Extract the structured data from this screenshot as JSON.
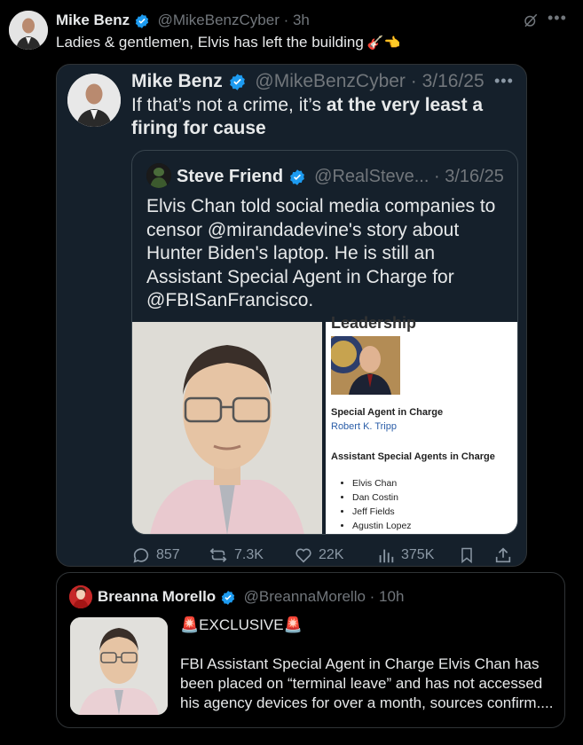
{
  "main_tweet": {
    "author_name": "Mike Benz",
    "handle_time": "@MikeBenzCyber · 3h",
    "text": "Ladies & gentlemen, Elvis has left the building",
    "emoji": "🎸👈"
  },
  "quote_tweet": {
    "author_name": "Mike Benz",
    "handle_time": "@MikeBenzCyber · 3/16/25",
    "text_plain": "If that’s not a crime, it’s ",
    "text_bold": "at the very least a firing for cause"
  },
  "nested_quote": {
    "author_name": "Steve Friend",
    "handle_time": "@RealSteve... · 3/16/25",
    "text": "Elvis Chan told social media companies to censor @mirandadevine's story about Hunter Biden's laptop. He is still an Assistant Special Agent in Charge for @FBISanFrancisco.",
    "document": {
      "header_cutoff": "Leadership",
      "sac_title": "Special Agent in Charge",
      "sac_name": "Robert K. Tripp",
      "asac_title": "Assistant Special Agents in Charge",
      "asac_names": [
        "Elvis Chan",
        "Dan Costin",
        "Jeff Fields",
        "Agustin Lopez"
      ]
    }
  },
  "actions": {
    "replies": "857",
    "reposts": "7.3K",
    "likes": "22K",
    "views": "375K"
  },
  "bottom_quote": {
    "author_name": "Breanna Morello",
    "handle_time": "@BreannaMorello · 10h",
    "label": "EXCLUSIVE",
    "label_emoji": "🚨",
    "text": "FBI Assistant Special Agent in Charge Elvis Chan has been placed on “terminal leave” and has not accessed his agency devices for over a month, sources confirm...."
  },
  "colors": {
    "background": "#000000",
    "card": "#15202b",
    "verified": "#1d9bf0",
    "secondary_text": "#71767b",
    "link_blue": "#2b5ea8"
  }
}
